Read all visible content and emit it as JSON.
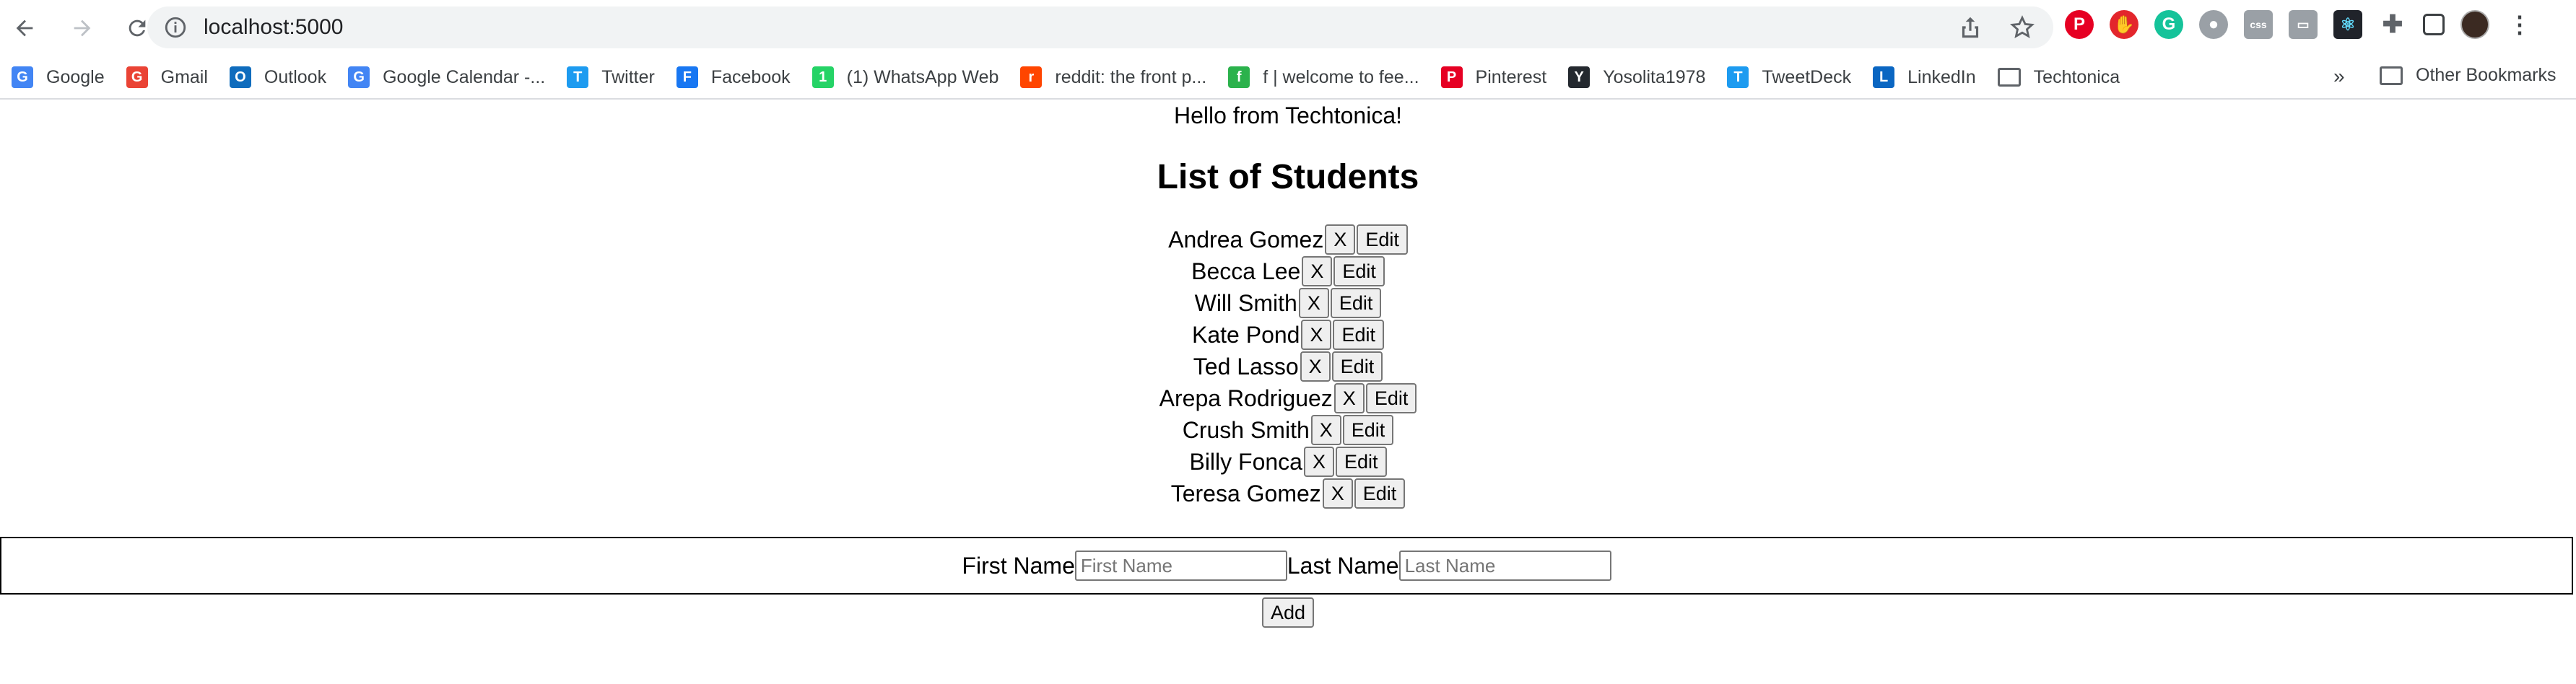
{
  "browser": {
    "url": "localhost:5000",
    "bookmarks": [
      {
        "label": "Google",
        "icon": "google-icon",
        "color": "#4285f4"
      },
      {
        "label": "Gmail",
        "icon": "gmail-icon",
        "color": "#ea4335"
      },
      {
        "label": "Outlook",
        "icon": "outlook-icon",
        "color": "#0f6cbd"
      },
      {
        "label": "Google Calendar -...",
        "icon": "calendar-icon",
        "color": "#4285f4"
      },
      {
        "label": "Twitter",
        "icon": "twitter-icon",
        "color": "#1d9bf0"
      },
      {
        "label": "Facebook",
        "icon": "facebook-icon",
        "color": "#1877f2"
      },
      {
        "label": "(1) WhatsApp Web",
        "icon": "whatsapp-icon",
        "color": "#25d366"
      },
      {
        "label": "reddit: the front p...",
        "icon": "reddit-icon",
        "color": "#ff4500"
      },
      {
        "label": "f | welcome to fee...",
        "icon": "feed-icon",
        "color": "#2bb24c"
      },
      {
        "label": "Pinterest",
        "icon": "pinterest-icon",
        "color": "#e60023"
      },
      {
        "label": "Yosolita1978",
        "icon": "github-icon",
        "color": "#24292f"
      },
      {
        "label": "TweetDeck",
        "icon": "tweetdeck-icon",
        "color": "#1d9bf0"
      },
      {
        "label": "LinkedIn",
        "icon": "linkedin-icon",
        "color": "#0a66c2"
      },
      {
        "label": "Techtonica",
        "icon": "folder-icon",
        "color": "#5f6368"
      }
    ],
    "more_label": "»",
    "other_bookmarks": "Other Bookmarks"
  },
  "page": {
    "hello": "Hello from Techtonica!",
    "title": "List of Students",
    "students": [
      {
        "name": "Andrea Gomez"
      },
      {
        "name": "Becca Lee"
      },
      {
        "name": "Will Smith"
      },
      {
        "name": "Kate Pond"
      },
      {
        "name": "Ted Lasso"
      },
      {
        "name": "Arepa Rodriguez"
      },
      {
        "name": "Crush Smith"
      },
      {
        "name": "Billy Fonca"
      },
      {
        "name": "Teresa Gomez"
      }
    ],
    "delete_label": "X",
    "edit_label": "Edit",
    "form": {
      "first_name_label": "First Name",
      "first_name_placeholder": "First Name",
      "first_name_value": "",
      "last_name_label": "Last Name",
      "last_name_placeholder": "Last Name",
      "last_name_value": "",
      "add_label": "Add"
    }
  }
}
